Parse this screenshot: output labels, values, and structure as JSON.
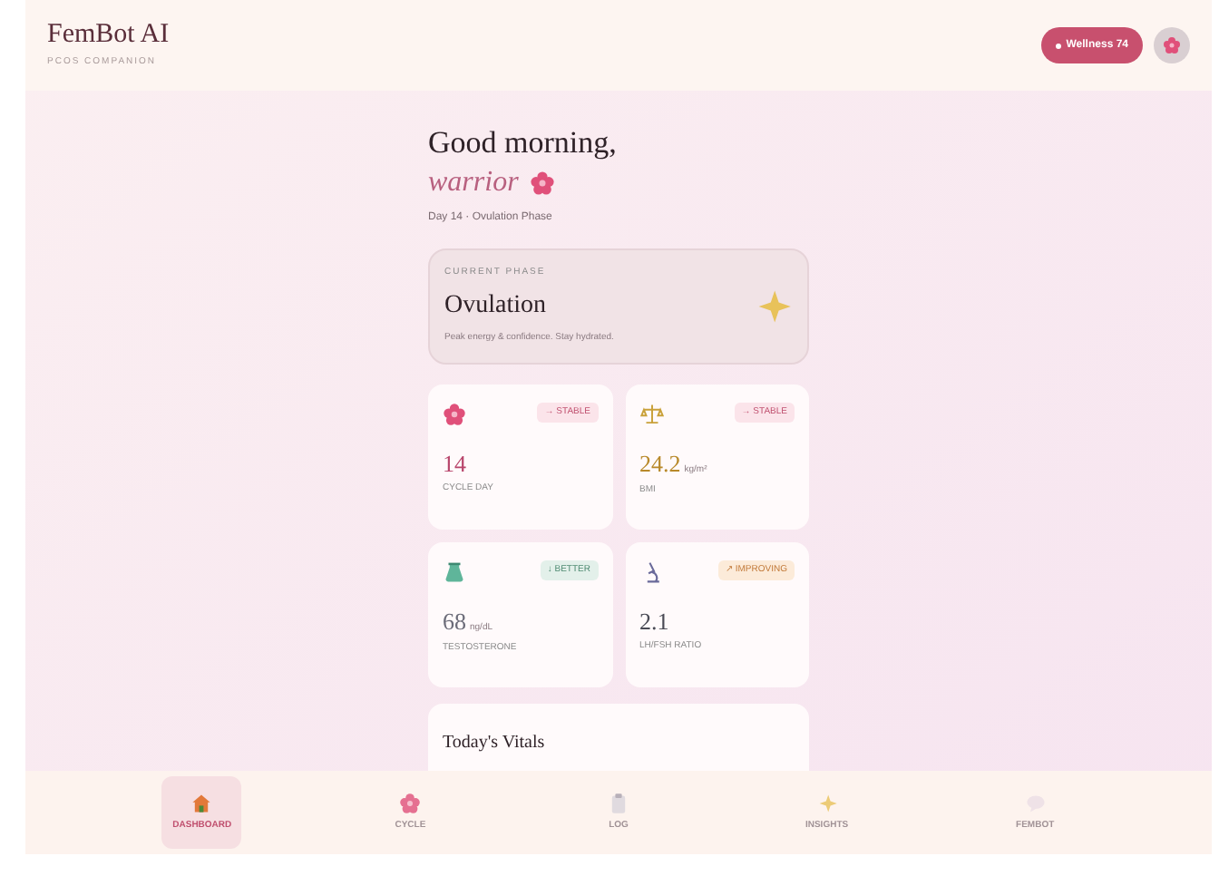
{
  "header": {
    "title": "FemBot AI",
    "subtitle": "PCOS COMPANION",
    "badge": "Wellness 74"
  },
  "greeting": {
    "line1": "Good morning,",
    "line2": "warrior",
    "subline": "Day 14 · Ovulation Phase"
  },
  "phase_card": {
    "label": "CURRENT PHASE",
    "title": "Ovulation",
    "note": "Peak energy & confidence. Stay hydrated."
  },
  "metrics": [
    {
      "trend": "→ STABLE",
      "kind": "stable",
      "value": "14",
      "label": "CYCLE DAY",
      "color": "#b8456b"
    },
    {
      "trend": "→ STABLE",
      "kind": "stable",
      "value": "24.2",
      "unit": "kg/m²",
      "label": "BMI",
      "color": "#b8892a"
    },
    {
      "trend": "↓ BETTER",
      "kind": "better",
      "value": "68",
      "unit": "ng/dL",
      "label": "TESTOSTERONE",
      "color": "#6b6b78"
    },
    {
      "trend": "↗ IMPROVING",
      "kind": "improving",
      "value": "2.1",
      "label": "LH/FSH RATIO",
      "color": "#4a4a55"
    }
  ],
  "vitals": {
    "title": "Today's Vitals"
  },
  "nav": [
    {
      "label": "DASHBOARD",
      "selected": true
    },
    {
      "label": "CYCLE",
      "selected": false
    },
    {
      "label": "LOG",
      "selected": false
    },
    {
      "label": "INSIGHTS",
      "selected": false
    },
    {
      "label": "FEMBOT",
      "selected": false
    }
  ]
}
